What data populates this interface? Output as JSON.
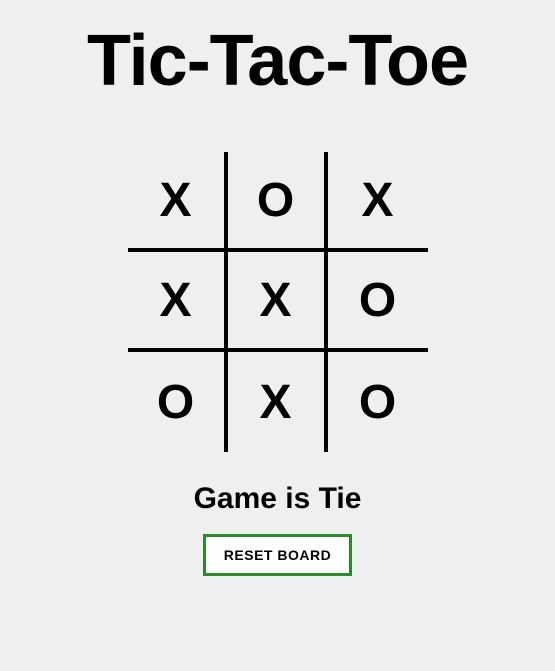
{
  "title": "Tic-Tac-Toe",
  "board": {
    "cells": [
      "X",
      "O",
      "X",
      "X",
      "X",
      "O",
      "O",
      "X",
      "O"
    ]
  },
  "status": "Game is Tie",
  "reset_label": "RESET BOARD",
  "colors": {
    "button_border": "#2a8a2a"
  }
}
